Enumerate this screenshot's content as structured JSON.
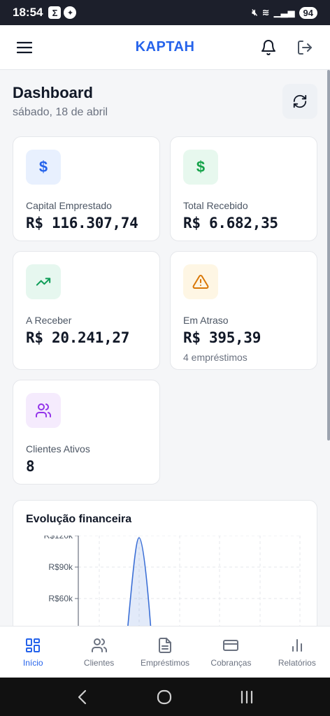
{
  "status": {
    "time": "18:54",
    "battery": "94"
  },
  "appbar": {
    "title": "KAPTAH"
  },
  "dashboard": {
    "title": "Dashboard",
    "date": "sábado, 18 de abril"
  },
  "cards": [
    {
      "label": "Capital Emprestado",
      "value": "R$ 116.307,74",
      "icon": "dollar-icon",
      "color": "#2563eb",
      "bg": "#e8f0fe"
    },
    {
      "label": "Total Recebido",
      "value": "R$ 6.682,35",
      "icon": "dollar-icon",
      "color": "#16a34a",
      "bg": "#e7f8ee"
    },
    {
      "label": "A Receber",
      "value": "R$ 20.241,27",
      "icon": "trending-up-icon",
      "color": "#0f9d58",
      "bg": "#e6f7ef"
    },
    {
      "label": "Em Atraso",
      "value": "R$ 395,39",
      "sub": "4 empréstimos",
      "icon": "warning-icon",
      "color": "#d97706",
      "bg": "#fef6e4"
    },
    {
      "label": "Clientes Ativos",
      "value": "8",
      "icon": "users-icon",
      "color": "#9333ea",
      "bg": "#f5ebfd"
    }
  ],
  "chart_data": {
    "type": "area",
    "title": "Evolução financeira",
    "yticks": [
      "R$120k",
      "R$90k",
      "R$60k"
    ],
    "ylim": [
      0,
      120000
    ],
    "series": [
      {
        "values": [
          0,
          118000,
          0
        ]
      }
    ],
    "color": "#3b6fd6"
  },
  "nav": [
    {
      "label": "Início",
      "icon": "grid-icon",
      "active": true
    },
    {
      "label": "Clientes",
      "icon": "users-icon",
      "active": false
    },
    {
      "label": "Empréstimos",
      "icon": "document-icon",
      "active": false
    },
    {
      "label": "Cobranças",
      "icon": "card-icon",
      "active": false
    },
    {
      "label": "Relatórios",
      "icon": "bar-chart-icon",
      "active": false
    }
  ]
}
